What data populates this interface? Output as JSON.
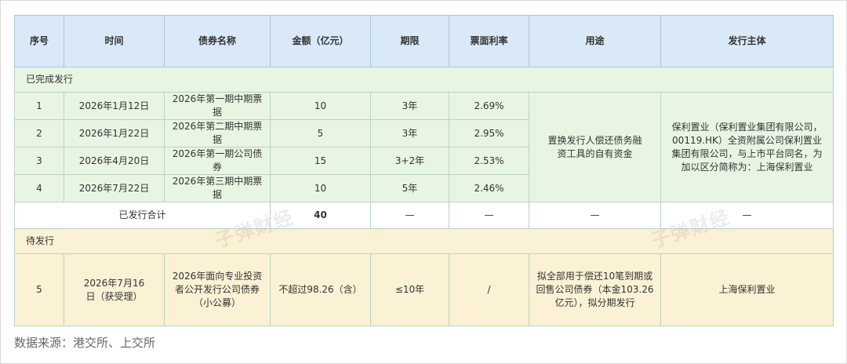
{
  "headers": [
    "序号",
    "时间",
    "债券名称",
    "金额（亿元）",
    "期限",
    "票面利率",
    "用途",
    "发行主体"
  ],
  "completed": {
    "label": "已完成发行",
    "rows": [
      {
        "no": "1",
        "date": "2026年1月12日",
        "name": "2026年第一期中期票据",
        "amount": "10",
        "term": "3年",
        "rate": "2.69%"
      },
      {
        "no": "2",
        "date": "2026年1月22日",
        "name": "2026年第二期中期票据",
        "amount": "5",
        "term": "3年",
        "rate": "2.95%"
      },
      {
        "no": "3",
        "date": "2026年4月20日",
        "name": "2026年第一期公司债券",
        "amount": "15",
        "term": "3+2年",
        "rate": "2.53%"
      },
      {
        "no": "4",
        "date": "2026年7月22日",
        "name": "2026年第三期中期票据",
        "amount": "10",
        "term": "5年",
        "rate": "2.46%"
      }
    ],
    "use": "置换发行人偿还债务融资工具的自有资金",
    "issuer": "保利置业（保利置业集团有限公司，00119.HK）全资附属公司保利置业集团有限公司，与上市平台同名，为加以区分简称为：上海保利置业"
  },
  "summary": {
    "label": "已发行合计",
    "amount": "40",
    "term": "—",
    "rate": "—",
    "use": "—",
    "issuer": "—"
  },
  "pending": {
    "label": "待发行",
    "row": {
      "no": "5",
      "date": "2026年7月16日（获受理）",
      "name": "2026年面向专业投资者公开发行公司债券（小公募）",
      "amount": "不超过98.26（含）",
      "term": "≤10年",
      "rate": "/",
      "use": "拟全部用于偿还10笔到期或回售公司债券（本金103.26亿元），拟分期发行",
      "issuer": "上海保利置业"
    }
  },
  "watermark": "子弹财经",
  "source_note": "数据来源：港交所、上交所"
}
